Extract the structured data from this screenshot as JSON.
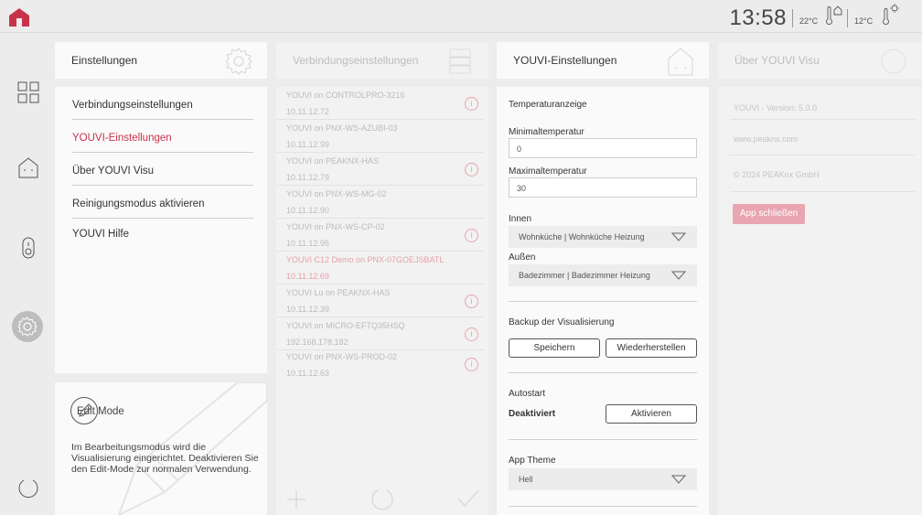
{
  "topbar": {
    "time": "13:58",
    "temp_inside": "22°C",
    "temp_outside": "12°C"
  },
  "colors": {
    "accent": "#c8334b",
    "close_button": "#e9a5b0"
  },
  "panels": {
    "settings": {
      "title": "Einstellungen",
      "items": [
        {
          "label": "Verbindungseinstellungen"
        },
        {
          "label": "YOUVI-Einstellungen",
          "active": true
        },
        {
          "label": "Über YOUVI Visu"
        },
        {
          "label": "Reinigungsmodus aktivieren"
        },
        {
          "label": "YOUVI Hilfe"
        }
      ]
    },
    "edit_mode": {
      "title": "Edit Mode",
      "text": "Im Bearbeitungsmodus wird die Visualisierung eingerichtet. Deaktivieren Sie den Edit-Mode zur normalen Verwendung."
    },
    "connections": {
      "title": "Verbindungseinstellungen",
      "items": [
        {
          "name": "YOUVI on CONTROLPRO-3216",
          "ip": "10.11.12.72",
          "info": true
        },
        {
          "name": "YOUVI on PNX-WS-AZUBI-03",
          "ip": "10.11.12.99",
          "info": false
        },
        {
          "name": "YOUVI on PEAKNX-HAS",
          "ip": "10.11.12.79",
          "info": true
        },
        {
          "name": "YOUVI on PNX-WS-MG-02",
          "ip": "10.11.12.90",
          "info": false
        },
        {
          "name": "YOUVI on PNX-WS-CP-02",
          "ip": "10.11.12.95",
          "info": true
        },
        {
          "name": "YOUVI C12 Demo on PNX-07GOEJSBATL",
          "ip": "10.11.12.69",
          "info": false,
          "selected": true
        },
        {
          "name": "YOUVI Lu on PEAKNX-HAS",
          "ip": "10.11.12.39",
          "info": true
        },
        {
          "name": "YOUVI on MICRO-EFTQ35HSQ",
          "ip": "192.168.178.182",
          "info": true
        },
        {
          "name": "YOUVI on PNX-WS-PROD-02",
          "ip": "10.11.12.63",
          "info": true
        }
      ]
    },
    "youvi": {
      "title": "YOUVI-Einstellungen",
      "temp_display_label": "Temperaturanzeige",
      "min_label": "Minimaltemperatur",
      "min_value": "0",
      "max_label": "Maximaltemperatur",
      "max_value": "30",
      "inside_label": "Innen",
      "inside_value": "Wohnküche | Wohnküche Heizung",
      "outside_label": "Außen",
      "outside_value": "Badezimmer | Badezimmer Heizung",
      "backup_label": "Backup der Visualisierung",
      "save_button": "Speichern",
      "restore_button": "Wiederherstellen",
      "autostart_label": "Autostart",
      "autostart_status": "Deaktiviert",
      "activate_button": "Aktivieren",
      "theme_label": "App Theme",
      "theme_value": "Hell"
    },
    "about": {
      "title": "Über YOUVI Visu",
      "version": "YOUVI - Version: 5.0.0",
      "website": "www.peaknx.com",
      "copyright": "© 2024 PEAKnx GmbH",
      "close_button": "App schließen"
    }
  }
}
